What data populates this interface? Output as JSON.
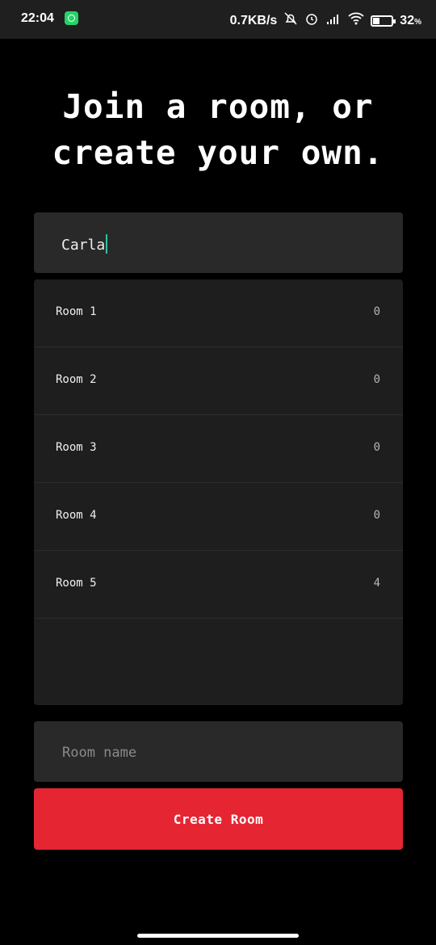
{
  "status_bar": {
    "time": "22:04",
    "net_speed": "0.7KB/s",
    "battery_percent": "32",
    "percent_sign": "%",
    "icons": [
      "whatsapp-icon",
      "bell-off-icon",
      "alarm-icon",
      "signal-icon",
      "wifi-icon",
      "battery-icon"
    ]
  },
  "heading": "Join a room, or\ncreate your own.",
  "name_input": {
    "value": "Carla"
  },
  "rooms": [
    {
      "name": "Room 1",
      "count": "0"
    },
    {
      "name": "Room 2",
      "count": "0"
    },
    {
      "name": "Room 3",
      "count": "0"
    },
    {
      "name": "Room 4",
      "count": "0"
    },
    {
      "name": "Room 5",
      "count": "4"
    }
  ],
  "room_name_input": {
    "placeholder": "Room name"
  },
  "create_button": {
    "label": "Create Room"
  },
  "colors": {
    "accent": "#e62533",
    "caret": "#2ec4a6",
    "background": "#000000"
  }
}
